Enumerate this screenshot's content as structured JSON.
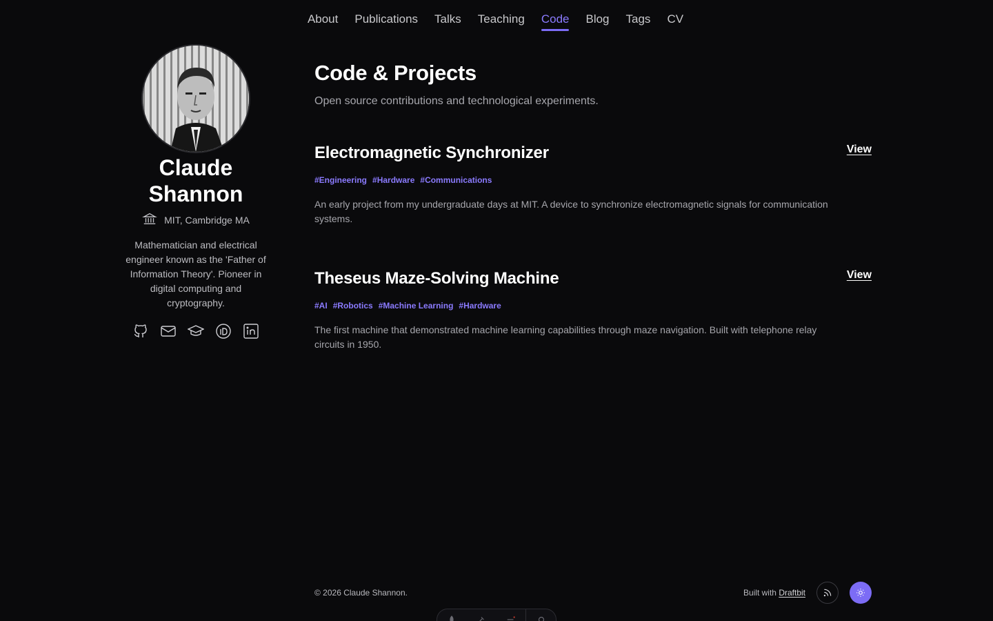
{
  "nav": {
    "items": [
      {
        "label": "About",
        "active": false
      },
      {
        "label": "Publications",
        "active": false
      },
      {
        "label": "Talks",
        "active": false
      },
      {
        "label": "Teaching",
        "active": false
      },
      {
        "label": "Code",
        "active": true
      },
      {
        "label": "Blog",
        "active": false
      },
      {
        "label": "Tags",
        "active": false
      },
      {
        "label": "CV",
        "active": false
      }
    ]
  },
  "profile": {
    "name": "Claude Shannon",
    "affiliation": "MIT, Cambridge MA",
    "bio": "Mathematician and electrical engineer known as the 'Father of Information Theory'. Pioneer in digital computing and cryptography.",
    "socials": [
      "github-icon",
      "email-icon",
      "scholar-icon",
      "orcid-icon",
      "linkedin-icon"
    ]
  },
  "page": {
    "title": "Code & Projects",
    "subtitle": "Open source contributions and technological experiments."
  },
  "projects": [
    {
      "title": "Electromagnetic Synchronizer",
      "link_label": "View",
      "tags": [
        "#Engineering",
        "#Hardware",
        "#Communications"
      ],
      "description": "An early project from my undergraduate days at MIT. A device to synchronize electromagnetic signals for communication systems."
    },
    {
      "title": "Theseus Maze-Solving Machine",
      "link_label": "View",
      "tags": [
        "#AI",
        "#Robotics",
        "#Machine Learning",
        "#Hardware"
      ],
      "description": "The first machine that demonstrated machine learning capabilities through maze navigation. Built with telephone relay circuits in 1950."
    }
  ],
  "footer": {
    "copyright": "© 2026 Claude Shannon.",
    "built_prefix": "Built with",
    "built_link": "Draftbit"
  },
  "colors": {
    "background": "#0a0a0c",
    "accent": "#7c6cf5",
    "tag": "#8b7bff"
  }
}
